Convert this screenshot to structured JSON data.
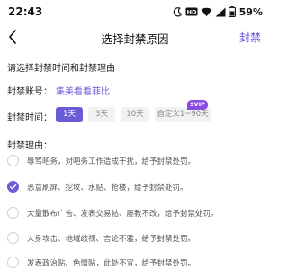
{
  "status_bar": {
    "time": "22:43",
    "battery_text": "59%",
    "icons": [
      "moon-icon",
      "hd-badge-icon",
      "wifi-icon",
      "signal-icon",
      "battery-icon"
    ]
  },
  "nav": {
    "title": "选择封禁原因",
    "action_label": "封禁",
    "back_icon": "chevron-left-icon"
  },
  "instruction": "请选择封禁时间和封禁理由",
  "account": {
    "label": "封禁账号：",
    "value": "集美看看菲比"
  },
  "ban_time": {
    "label": "封禁时间：",
    "options": [
      {
        "label": "1天",
        "selected": true
      },
      {
        "label": "3天",
        "selected": false
      },
      {
        "label": "10天",
        "selected": false
      },
      {
        "label": "自定义1~90天",
        "selected": false,
        "badge": "SVIP"
      }
    ]
  },
  "reasons": {
    "title": "封禁理由：",
    "items": [
      {
        "text": "辱骂吧务，对吧务工作造成干扰，给予封禁处罚。",
        "checked": false
      },
      {
        "text": "恶意刷屏、挖坟、水贴、抢楼，给予封禁处罚。",
        "checked": true
      },
      {
        "text": "大量散布广告、发表交易帖、屡教不改，给予封禁处罚。",
        "checked": false
      },
      {
        "text": "人身攻击、地域歧视、言论不雅，给予封禁处罚。",
        "checked": false
      },
      {
        "text": "发表政治贴、色情贴，此处不宜，给予封禁处罚。",
        "checked": false
      }
    ]
  },
  "colors": {
    "accent": "#6a5bd6",
    "svip_badge": "#8a4be0",
    "chip_bg": "#f2f2f5"
  }
}
